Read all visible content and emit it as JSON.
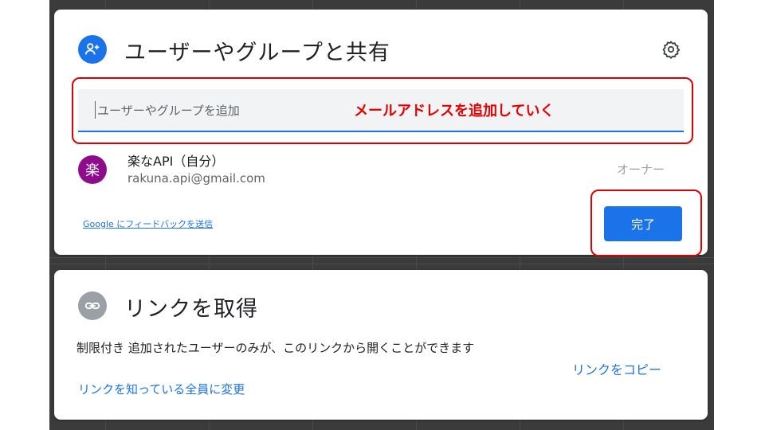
{
  "share": {
    "title": "ユーザーやグループと共有",
    "input_placeholder": "ユーザーやグループを追加",
    "annotation": "メールアドレスを追加していく",
    "user": {
      "avatar_char": "楽",
      "name": "楽なAPI（自分）",
      "email": "rakuna.api@gmail.com",
      "role": "オーナー"
    },
    "feedback_link": "Google にフィードバックを送信",
    "done_label": "完了"
  },
  "link": {
    "title": "リンクを取得",
    "description": "制限付き 追加されたユーザーのみが、このリンクから開くことができます",
    "change_link": "リンクを知っている全員に変更",
    "copy_link": "リンクをコピー"
  },
  "colors": {
    "accent": "#1a73e8",
    "annotation": "#e60000",
    "avatar": "#8e0c8c",
    "link_icon_bg": "#9aa0a6"
  },
  "icons": {
    "share_icon": "person-add-icon",
    "settings_icon": "gear-icon",
    "link_icon": "link-icon"
  }
}
